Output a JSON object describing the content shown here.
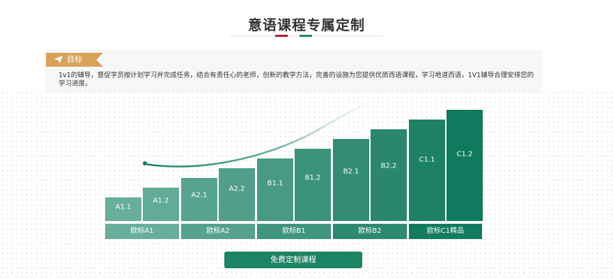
{
  "page": {
    "title": "意语课程专属定制"
  },
  "goal": {
    "tag": "目标",
    "text": "1v1的辅导，督促学员按计划学习并完成任务，结合有责任心的老师，创新的教学方法，完善的设施为您提供优质西语课程，学习地道西语，1V1辅导合理安排您的学习进度。"
  },
  "levels": [
    {
      "label": "A1.1",
      "color": "#67ae9b"
    },
    {
      "label": "A1.2",
      "color": "#62ab97"
    },
    {
      "label": "A2.1",
      "color": "#58a48f"
    },
    {
      "label": "A2.2",
      "color": "#519f89"
    },
    {
      "label": "B1.1",
      "color": "#489a83"
    },
    {
      "label": "B1.2",
      "color": "#3c937b"
    },
    {
      "label": "B2.1",
      "color": "#338c74"
    },
    {
      "label": "B2.2",
      "color": "#2a876e"
    },
    {
      "label": "C1.1",
      "color": "#1d8166"
    },
    {
      "label": "C1.2",
      "color": "#107a5e"
    }
  ],
  "groups": [
    {
      "label": "欧标A1",
      "color": "#67ae9b"
    },
    {
      "label": "欧标A2",
      "color": "#56a38d"
    },
    {
      "label": "欧标B1",
      "color": "#3f957d"
    },
    {
      "label": "欧标B2",
      "color": "#2d896f"
    },
    {
      "label": "欧标C1精品",
      "color": "#137b5f"
    }
  ],
  "cta": {
    "label": "免费定制课程"
  }
}
